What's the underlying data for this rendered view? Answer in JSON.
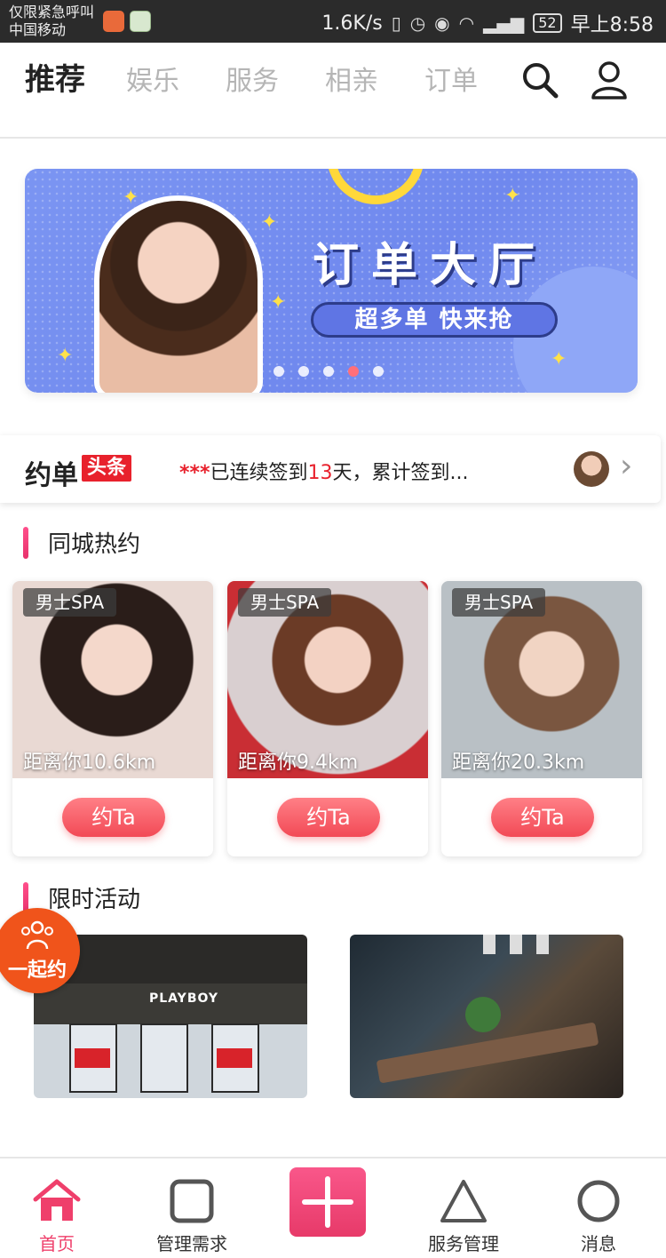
{
  "status_bar": {
    "carrier_line1": "仅限紧急呼叫",
    "carrier_line2": "中国移动",
    "net_speed": "1.6K/s",
    "battery": "52",
    "time": "早上8:58"
  },
  "top_nav": {
    "tabs": [
      {
        "label": "推荐",
        "active": true
      },
      {
        "label": "娱乐",
        "active": false
      },
      {
        "label": "服务",
        "active": false
      },
      {
        "label": "相亲",
        "active": false
      },
      {
        "label": "订单",
        "active": false
      }
    ],
    "icons": [
      "search-icon",
      "user-icon"
    ]
  },
  "banner": {
    "title": "订单大厅",
    "subtitle": "超多单 快来抢",
    "page_count": 5,
    "active_index": 3
  },
  "headline": {
    "logo": "约单",
    "badge": "头条",
    "stars": "***",
    "text_before": "已连续签到",
    "days": "13",
    "text_after": "天，累计签到..."
  },
  "nearby": {
    "section_title": "同城热约",
    "cards": [
      {
        "tag": "男士SPA",
        "distance": "距离你10.6km",
        "button": "约Ta"
      },
      {
        "tag": "男士SPA",
        "distance": "距离你9.4km",
        "button": "约Ta"
      },
      {
        "tag": "男士SPA",
        "distance": "距离你20.3km",
        "button": "约Ta"
      }
    ]
  },
  "activities": {
    "section_title": "限时活动",
    "store_sign": "PLAYBOY"
  },
  "float_badge": {
    "label": "一起约"
  },
  "bottom_nav": {
    "items": [
      {
        "label": "首页",
        "active": true
      },
      {
        "label": "管理需求",
        "active": false
      },
      {
        "label": "服务管理",
        "active": false
      },
      {
        "label": "消息",
        "active": false
      }
    ]
  },
  "colors": {
    "accent": "#ef3f6b",
    "headline_red": "#e8212c",
    "banner_blue": "#7b95f2",
    "float_orange": "#f0541b"
  }
}
